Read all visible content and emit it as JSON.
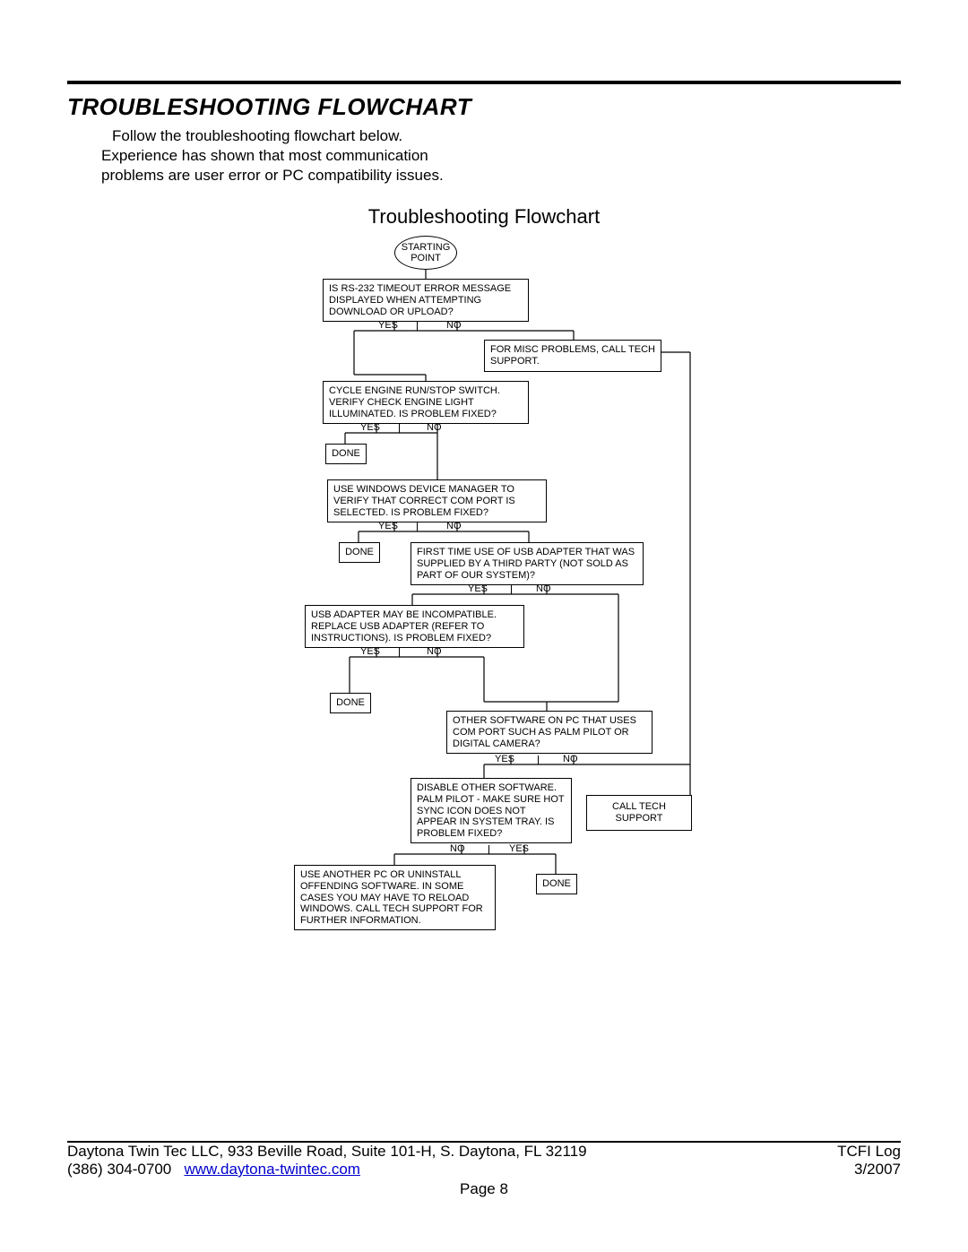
{
  "header": {
    "section_title": "TROUBLESHOOTING FLOWCHART",
    "intro_line1": "Follow the troubleshooting flowchart below.",
    "intro_line2": "Experience has shown that most communication",
    "intro_line3": "problems are user error or PC compatibility issues.",
    "subtitle": "Troubleshooting Flowchart"
  },
  "flow": {
    "start": "STARTING POINT",
    "q1": "IS RS-232 TIMEOUT ERROR MESSAGE DISPLAYED WHEN ATTEMPTING DOWNLOAD OR UPLOAD?",
    "q1_misc": "FOR MISC PROBLEMS, CALL TECH SUPPORT.",
    "q2": "CYCLE ENGINE RUN/STOP SWITCH. VERIFY CHECK ENGINE LIGHT ILLUMINATED. IS PROBLEM FIXED?",
    "q3": "USE WINDOWS DEVICE MANAGER TO VERIFY THAT CORRECT COM PORT IS SELECTED. IS PROBLEM FIXED?",
    "q4": "FIRST TIME USE OF USB ADAPTER THAT WAS SUPPLIED BY A THIRD PARTY (NOT SOLD AS PART OF OUR SYSTEM)?",
    "q5": "USB ADAPTER MAY BE INCOMPATIBLE. REPLACE USB ADAPTER (REFER TO INSTRUCTIONS). IS PROBLEM FIXED?",
    "q6": "OTHER SOFTWARE ON PC THAT USES COM PORT SUCH AS PALM PILOT OR DIGITAL CAMERA?",
    "q7": "DISABLE OTHER SOFTWARE. PALM PILOT - MAKE SURE HOT SYNC ICON DOES NOT APPEAR IN SYSTEM TRAY. IS PROBLEM FIXED?",
    "call_tech": "CALL TECH SUPPORT",
    "q8": "USE ANOTHER PC OR UNINSTALL OFFENDING SOFTWARE. IN SOME CASES YOU MAY HAVE TO RELOAD WINDOWS. CALL TECH SUPPORT FOR FURTHER INFORMATION.",
    "done": "DONE",
    "yes": "YES",
    "no": "NO"
  },
  "footer": {
    "company_line": "Daytona Twin Tec LLC, 933 Beville Road, Suite 101-H, S. Daytona, FL 32119",
    "doc": "TCFI Log",
    "phone": "(386) 304-0700",
    "url": "www.daytona-twintec.com",
    "date": "3/2007",
    "page": "Page 8"
  }
}
